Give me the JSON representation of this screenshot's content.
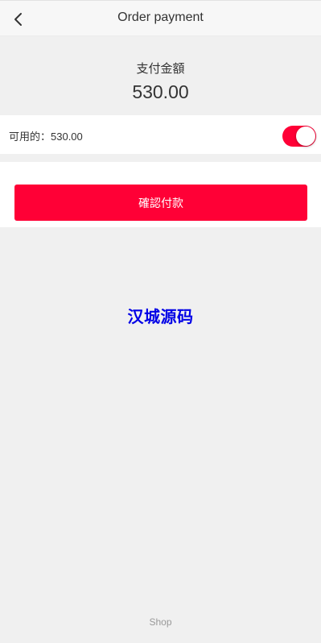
{
  "header": {
    "title": "Order payment",
    "back_icon": "chevron-left-icon"
  },
  "payment": {
    "amount_label": "支付金額",
    "amount_value": "530.00"
  },
  "balance": {
    "text": "可用的：530.00",
    "toggle_on": true
  },
  "actions": {
    "confirm_label": "確認付款"
  },
  "watermark": {
    "text": "汉城源码"
  },
  "footer": {
    "text": "Shop"
  },
  "colors": {
    "accent": "#ff0036",
    "watermark": "#0000e6",
    "header_bg": "#f7f7f7",
    "page_bg": "#f0f0f0"
  }
}
